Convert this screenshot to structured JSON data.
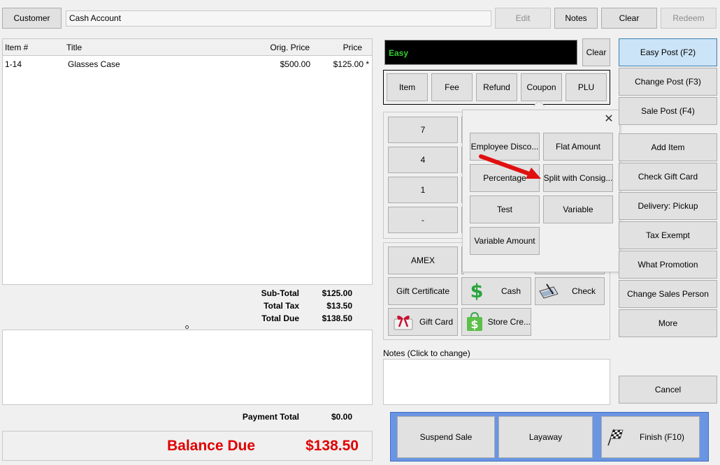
{
  "top_bar": {
    "customer_button": "Customer",
    "customer_value": "Cash Account",
    "edit_button": "Edit",
    "notes_button": "Notes",
    "clear_button": "Clear",
    "redeem_button": "Redeem"
  },
  "items_table": {
    "headers": [
      "Item #",
      "Title",
      "Orig. Price",
      "Price"
    ],
    "rows": [
      {
        "item_no": "1-14",
        "title": "Glasses Case",
        "orig_price": "$500.00",
        "price": "$125.00 *"
      }
    ]
  },
  "totals": {
    "subtotal_label": "Sub-Total",
    "subtotal_value": "$125.00",
    "tax_label": "Total Tax",
    "tax_value": "$13.50",
    "due_label": "Total Due",
    "due_value": "$138.50",
    "payment_label": "Payment Total",
    "payment_value": "$0.00",
    "balance_label": "Balance Due",
    "balance_value": "$138.50"
  },
  "entry": {
    "display_text": "Easy",
    "clear_button": "Clear"
  },
  "item_type_buttons": [
    "Item",
    "Fee",
    "Refund",
    "Coupon",
    "PLU"
  ],
  "keypad": [
    "7",
    "4",
    "1",
    "-"
  ],
  "payments": {
    "amex": "AMEX",
    "gift_certificate": "Gift Certificate",
    "cash": "Cash",
    "check": "Check",
    "gift_card": "Gift Card",
    "store_credit": "Store Cre..."
  },
  "coupon_popup": {
    "options": [
      "Employee Disco...",
      "Flat Amount",
      "Percentage",
      "Split with Consig...",
      "Test",
      "Variable",
      "Variable Amount"
    ],
    "close_glyph": "✕"
  },
  "notes": {
    "label": "Notes (Click to change)"
  },
  "right_panel": {
    "post_buttons": [
      "Easy Post (F2)",
      "Change Post (F3)",
      "Sale Post (F4)"
    ],
    "action_buttons": [
      "Add Item",
      "Check Gift Card",
      "Delivery: Pickup",
      "Tax Exempt",
      "What Promotion",
      "Change Sales Person",
      "More"
    ],
    "cancel_button": "Cancel"
  },
  "bottom_actions": {
    "suspend": "Suspend Sale",
    "layaway": "Layaway",
    "finish": "Finish (F10)"
  },
  "colors": {
    "balance_red": "#e00000",
    "display_green": "#33cc33",
    "bottom_panel_blue": "#6a95e3",
    "selected_blue": "#cce4f7",
    "arrow_red": "#e01010"
  },
  "icons": {
    "cash": "dollar-sign-icon",
    "check": "check-writing-icon",
    "gift_card": "gift-ribbon-icon",
    "store_credit": "shopping-bag-dollar-icon",
    "finish": "checkered-flag-icon"
  }
}
